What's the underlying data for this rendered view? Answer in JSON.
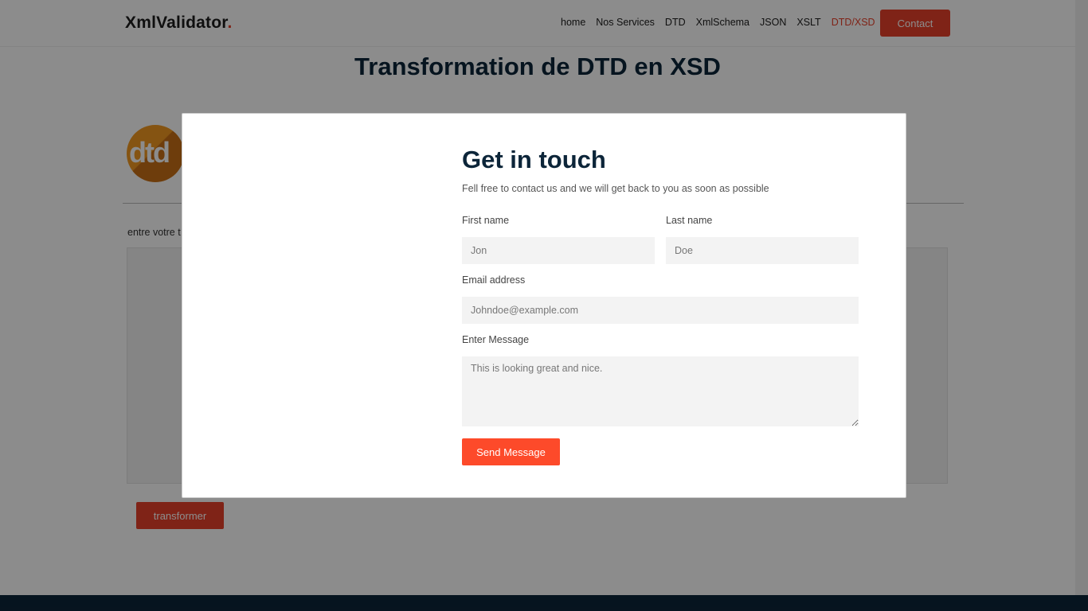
{
  "brand": {
    "name": "XmlValidator",
    "dot": "."
  },
  "nav": {
    "items": [
      {
        "label": "home",
        "active": false
      },
      {
        "label": "Nos Services",
        "active": false
      },
      {
        "label": "DTD",
        "active": false
      },
      {
        "label": "XmlSchema",
        "active": false
      },
      {
        "label": "JSON",
        "active": false
      },
      {
        "label": "XSLT",
        "active": false
      },
      {
        "label": "DTD/XSD",
        "active": true
      }
    ],
    "contact_label": "Contact"
  },
  "page": {
    "title": "Transformation de DTD en XSD",
    "logo_text": "dtd",
    "input_label": "entre votre t",
    "transform_label": "transformer"
  },
  "colors": {
    "accent": "#e8412a",
    "dark": "#0c2539",
    "send": "#fd4a2a"
  },
  "modal": {
    "title": "Get in touch",
    "subtitle": "Fell free to contact us and we will get back to you as soon as possible",
    "first_name": {
      "label": "First name",
      "placeholder": "Jon"
    },
    "last_name": {
      "label": "Last name",
      "placeholder": "Doe"
    },
    "email": {
      "label": "Email address",
      "placeholder": "Johndoe@example.com"
    },
    "message": {
      "label": "Enter Message",
      "placeholder": "This is looking great and nice."
    },
    "send_label": "Send Message"
  }
}
